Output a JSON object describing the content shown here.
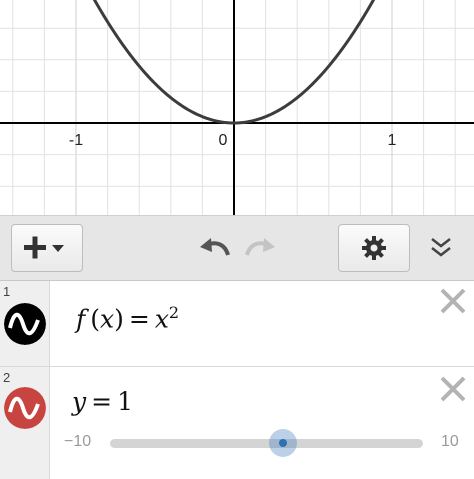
{
  "graph": {
    "x_ticks": [
      "-1",
      "0",
      "1"
    ],
    "functions": [
      "x^2",
      "1"
    ],
    "colors": {
      "parabola": "#3c3c3c",
      "line": "#c74440",
      "grid": "#e2e2e2",
      "axis": "#000000"
    }
  },
  "toolbar": {
    "add_icon": "plus-dropdown-icon",
    "undo_icon": "undo-icon",
    "redo_icon": "redo-icon",
    "settings_icon": "gear-icon",
    "collapse_icon": "double-chevron-down-icon"
  },
  "expressions": [
    {
      "index": "1",
      "fx": "f",
      "arg": "x",
      "rhs_base": "x",
      "rhs_exp": "2",
      "color": "#000000"
    },
    {
      "index": "2",
      "lhs": "y",
      "rhs": "1",
      "color": "#c74440",
      "slider": {
        "min": "−10",
        "max": "10",
        "value": 1
      }
    }
  ]
}
